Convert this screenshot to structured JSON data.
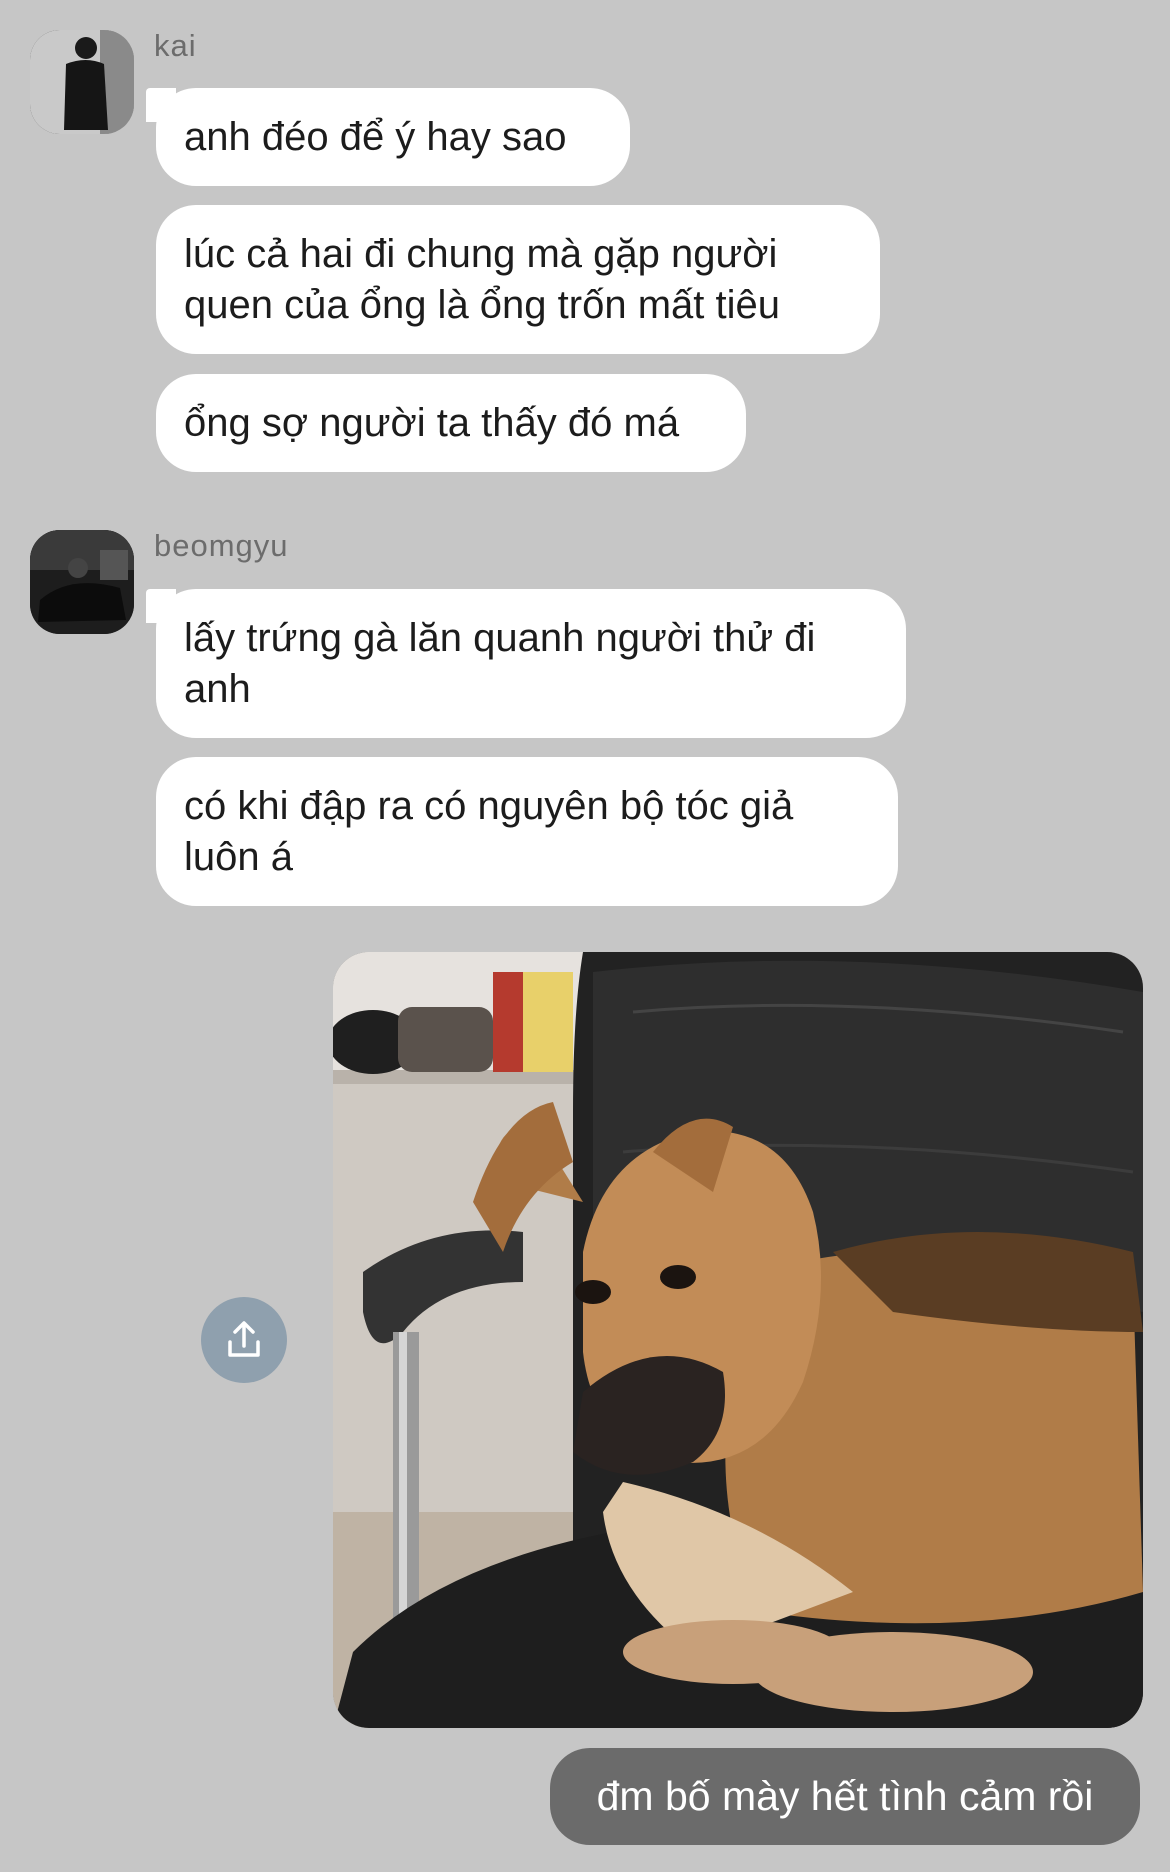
{
  "messages": [
    {
      "sender": "kai",
      "avatar_icon": "user-avatar-icon",
      "bubbles": [
        "anh đéo để ý hay sao",
        "lúc cả hai đi chung mà gặp người quen của ổng là ổng trốn mất tiêu",
        "ổng sợ người ta thấy đó má"
      ]
    },
    {
      "sender": "beomgyu",
      "avatar_icon": "user-avatar-icon",
      "bubbles": [
        "lấy trứng gà lăn quanh người thử đi anh",
        "có khi đập ra có nguyên bộ tóc giả luôn á"
      ]
    }
  ],
  "outgoing": {
    "image_icon": "sad-dog-photo",
    "share_icon": "share-icon",
    "text": "đm bố mày hết tình cảm rồi"
  },
  "colors": {
    "background": "#c6c6c6",
    "incoming_bubble": "#ffffff",
    "outgoing_bubble": "#6b6b6b",
    "share_button": "#8fa0ae"
  }
}
